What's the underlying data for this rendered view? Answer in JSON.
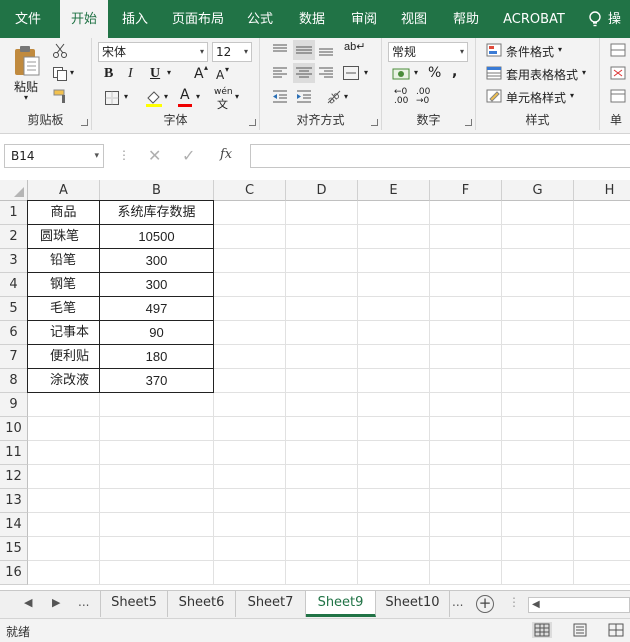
{
  "ribbon_tabs": [
    "文件",
    "开始",
    "插入",
    "页面布局",
    "公式",
    "数据",
    "审阅",
    "视图",
    "帮助",
    "ACROBAT"
  ],
  "active_tab": "开始",
  "tell_me": "操",
  "clipboard": {
    "paste": "粘贴",
    "label": "剪贴板"
  },
  "font": {
    "name": "宋体",
    "size": "12",
    "label": "字体",
    "bold": "B",
    "italic": "I",
    "underline": "U",
    "grow": "A",
    "shrink": "A",
    "font_color": "A",
    "wen": "wén"
  },
  "alignment": {
    "label": "对齐方式"
  },
  "number": {
    "format": "常规",
    "percent": "%",
    "comma": ",",
    "label": "数字"
  },
  "styles": {
    "conditional": "条件格式",
    "table": "套用表格格式",
    "cell": "单元格样式",
    "label": "样式"
  },
  "cells_group": {
    "label": "单"
  },
  "name_box": "B14",
  "fx": "fx",
  "columns": [
    "A",
    "B",
    "C",
    "D",
    "E",
    "F",
    "G",
    "H"
  ],
  "rows": [
    "1",
    "2",
    "3",
    "4",
    "5",
    "6",
    "7",
    "8",
    "9",
    "10",
    "11",
    "12",
    "13",
    "14",
    "15",
    "16"
  ],
  "table": {
    "headers": [
      "商品",
      "系统库存数据"
    ],
    "rows": [
      [
        "圆珠笔",
        "10500"
      ],
      [
        "铅笔",
        "300"
      ],
      [
        "钢笔",
        "300"
      ],
      [
        "毛笔",
        "497"
      ],
      [
        "记事本",
        "90"
      ],
      [
        "便利贴",
        "180"
      ],
      [
        "涂改液",
        "370"
      ]
    ]
  },
  "sheets": [
    "Sheet5",
    "Sheet6",
    "Sheet7",
    "Sheet9",
    "Sheet10"
  ],
  "active_sheet": "Sheet9",
  "sheet_nav_ellipsis": "...",
  "status": "就绪",
  "colors": {
    "accent": "#217346"
  }
}
